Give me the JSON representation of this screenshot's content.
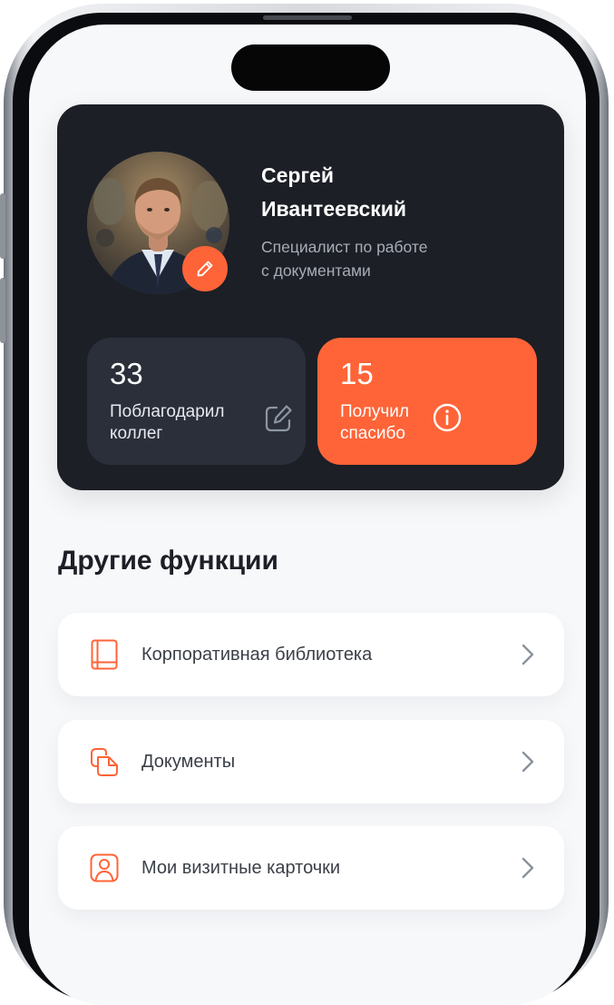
{
  "colors": {
    "accent": "#ff6438",
    "card_bg": "#1c1f26",
    "stat_bg": "#2a2f3a",
    "screen_bg": "#f7f8fa"
  },
  "profile": {
    "name_line1": "Сергей",
    "name_line2": "Ивантеевский",
    "role_line1": "Специалист по работе",
    "role_line2": "с документами",
    "avatar": "user-photo",
    "edit_icon": "pencil-icon"
  },
  "stats": [
    {
      "value": "33",
      "label_line1": "Поблагодарил",
      "label_line2": "коллег",
      "icon": "edit-square-icon"
    },
    {
      "value": "15",
      "label_line1": "Получил",
      "label_line2": "спасибо",
      "icon": "info-icon"
    }
  ],
  "section": {
    "title": "Другие функции"
  },
  "menu": [
    {
      "label": "Корпоративная библиотека",
      "icon": "book-icon"
    },
    {
      "label": "Документы",
      "icon": "documents-icon"
    },
    {
      "label": "Мои визитные карточки",
      "icon": "contact-card-icon"
    }
  ]
}
